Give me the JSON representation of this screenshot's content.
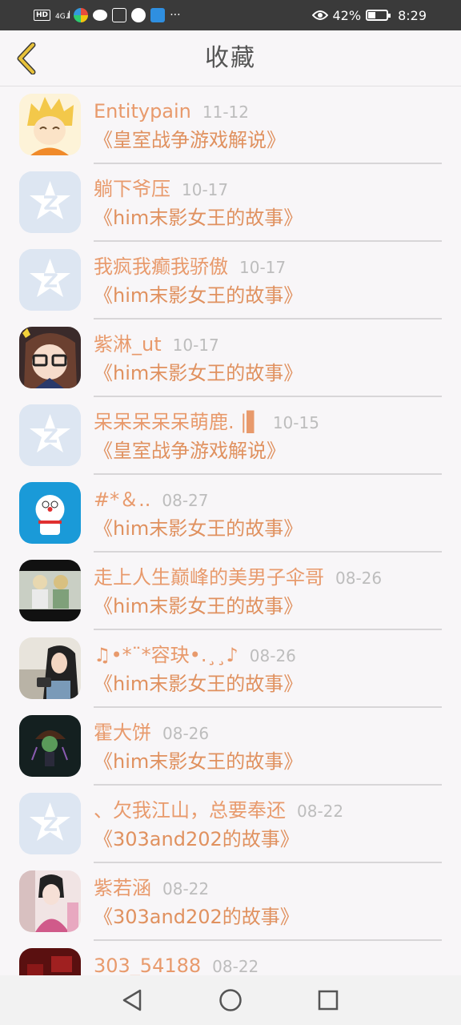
{
  "status_bar": {
    "left_icons": [
      "hd-icon",
      "4g-signal-icon",
      "app-icon",
      "wechat-icon",
      "app-icon",
      "app-icon",
      "app-icon"
    ],
    "hd_label": "HD",
    "network_label": "4G",
    "more_dots": "···",
    "battery_percent": "42%",
    "battery_level": 0.42,
    "time": "8:29"
  },
  "header": {
    "title": "收藏",
    "back_icon": "chevron-left-icon"
  },
  "favorites": [
    {
      "name": "Entitypain",
      "date": "11-12",
      "story": "《皇室战争游戏解说》",
      "avatar": "cartoon-character"
    },
    {
      "name": "躺下爷压",
      "date": "10-17",
      "story": "《him末影女王的故事》",
      "avatar": "default-star"
    },
    {
      "name": "我疯我癫我骄傲",
      "date": "10-17",
      "story": "《him末影女王的故事》",
      "avatar": "default-star"
    },
    {
      "name": "紫淋_ut",
      "date": "10-17",
      "story": "《him末影女王的故事》",
      "avatar": "anime-girl-glasses"
    },
    {
      "name": "呆呆呆呆呆萌鹿. |▌",
      "date": "10-15",
      "story": "《皇室战争游戏解说》",
      "avatar": "default-star"
    },
    {
      "name": "#*＆..",
      "date": "08-27",
      "story": "《him末影女王的故事》",
      "avatar": "doraemon"
    },
    {
      "name": "走上人生巅峰的美男子伞哥",
      "date": "08-26",
      "story": "《him末影女王的故事》",
      "avatar": "photo-people"
    },
    {
      "name": "♫•*¨*容玦•.¸¸♪",
      "date": "08-26",
      "story": "《him末影女王的故事》",
      "avatar": "photo-girl-camera"
    },
    {
      "name": "霍大饼",
      "date": "08-26",
      "story": "《him末影女王的故事》",
      "avatar": "dark-game-character"
    },
    {
      "name": "、欠我江山，总要奉还",
      "date": "08-22",
      "story": "《303and202的故事》",
      "avatar": "default-star"
    },
    {
      "name": "紫若涵",
      "date": "08-22",
      "story": "《303and202的故事》",
      "avatar": "photo-costume-girl"
    },
    {
      "name": "303_54188",
      "date": "08-22",
      "story": "",
      "avatar": "dark-red"
    }
  ],
  "nav_bar": {
    "back": "triangle-back-icon",
    "home": "circle-home-icon",
    "recents": "square-recents-icon"
  },
  "colors": {
    "name": "#e89a6c",
    "story": "#e0915f",
    "date": "#bdbdbd",
    "title": "#555555",
    "back_arrow": "#e8b82a"
  }
}
